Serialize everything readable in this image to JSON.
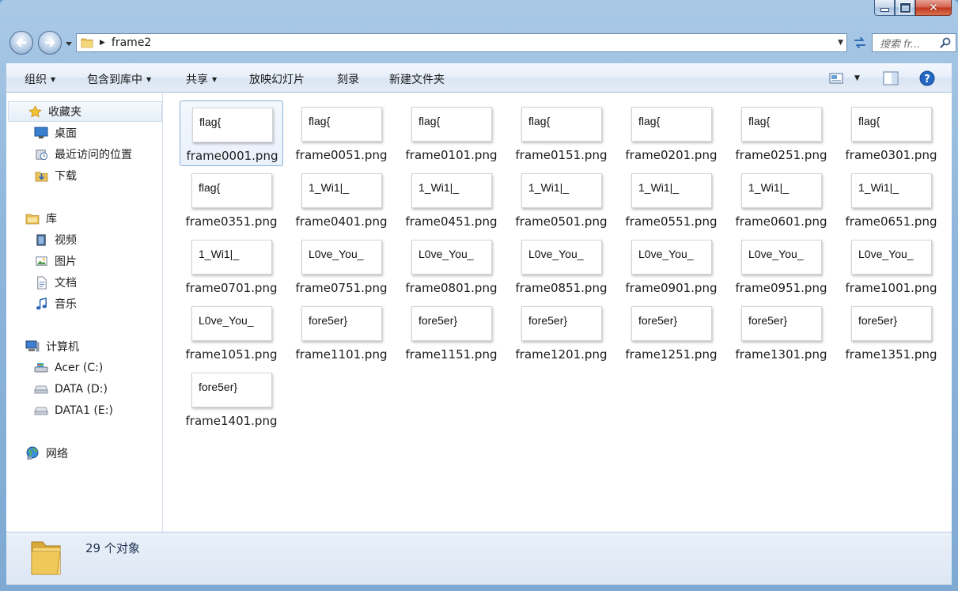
{
  "window": {
    "caption_buttons": {
      "minimize": "minimize-icon",
      "maximize": "maximize-icon",
      "close": "close-icon"
    }
  },
  "address": {
    "path": "frame2",
    "search_placeholder": "搜索 fr..."
  },
  "toolbar": {
    "organize": "组织",
    "include_in_library": "包含到库中",
    "share": "共享",
    "slideshow": "放映幻灯片",
    "burn": "刻录",
    "new_folder": "新建文件夹"
  },
  "nav": {
    "favorites": {
      "label": "收藏夹",
      "items": [
        {
          "label": "桌面",
          "icon": "desktop-icon"
        },
        {
          "label": "最近访问的位置",
          "icon": "recent-places-icon"
        },
        {
          "label": "下载",
          "icon": "downloads-folder-icon"
        }
      ]
    },
    "libraries": {
      "label": "库",
      "items": [
        {
          "label": "视频",
          "icon": "videos-library-icon"
        },
        {
          "label": "图片",
          "icon": "pictures-library-icon"
        },
        {
          "label": "文档",
          "icon": "documents-library-icon"
        },
        {
          "label": "音乐",
          "icon": "music-library-icon"
        }
      ]
    },
    "computer": {
      "label": "计算机",
      "items": [
        {
          "label": "Acer (C:)",
          "icon": "system-drive-icon"
        },
        {
          "label": "DATA (D:)",
          "icon": "drive-icon"
        },
        {
          "label": "DATA1 (E:)",
          "icon": "drive-icon"
        }
      ]
    },
    "network": {
      "label": "网络"
    }
  },
  "files": [
    {
      "name": "frame0001.png",
      "thumb": "flag{"
    },
    {
      "name": "frame0051.png",
      "thumb": "flag{"
    },
    {
      "name": "frame0101.png",
      "thumb": "flag{"
    },
    {
      "name": "frame0151.png",
      "thumb": "flag{"
    },
    {
      "name": "frame0201.png",
      "thumb": "flag{"
    },
    {
      "name": "frame0251.png",
      "thumb": "flag{"
    },
    {
      "name": "frame0301.png",
      "thumb": "flag{"
    },
    {
      "name": "frame0351.png",
      "thumb": "flag{"
    },
    {
      "name": "frame0401.png",
      "thumb": "1_Wi1|_"
    },
    {
      "name": "frame0451.png",
      "thumb": "1_Wi1|_"
    },
    {
      "name": "frame0501.png",
      "thumb": "1_Wi1|_"
    },
    {
      "name": "frame0551.png",
      "thumb": "1_Wi1|_"
    },
    {
      "name": "frame0601.png",
      "thumb": "1_Wi1|_"
    },
    {
      "name": "frame0651.png",
      "thumb": "1_Wi1|_"
    },
    {
      "name": "frame0701.png",
      "thumb": "1_Wi1|_"
    },
    {
      "name": "frame0751.png",
      "thumb": "L0ve_You_"
    },
    {
      "name": "frame0801.png",
      "thumb": "L0ve_You_"
    },
    {
      "name": "frame0851.png",
      "thumb": "L0ve_You_"
    },
    {
      "name": "frame0901.png",
      "thumb": "L0ve_You_"
    },
    {
      "name": "frame0951.png",
      "thumb": "L0ve_You_"
    },
    {
      "name": "frame1001.png",
      "thumb": "L0ve_You_"
    },
    {
      "name": "frame1051.png",
      "thumb": "L0ve_You_"
    },
    {
      "name": "frame1101.png",
      "thumb": "fore5er}"
    },
    {
      "name": "frame1151.png",
      "thumb": "fore5er}"
    },
    {
      "name": "frame1201.png",
      "thumb": "fore5er}"
    },
    {
      "name": "frame1251.png",
      "thumb": "fore5er}"
    },
    {
      "name": "frame1301.png",
      "thumb": "fore5er}"
    },
    {
      "name": "frame1351.png",
      "thumb": "fore5er}"
    },
    {
      "name": "frame1401.png",
      "thumb": "fore5er}"
    }
  ],
  "status": {
    "count_text": "29 个对象"
  },
  "colors": {
    "accent": "#2b5797",
    "selection_border": "#8db0d6"
  }
}
